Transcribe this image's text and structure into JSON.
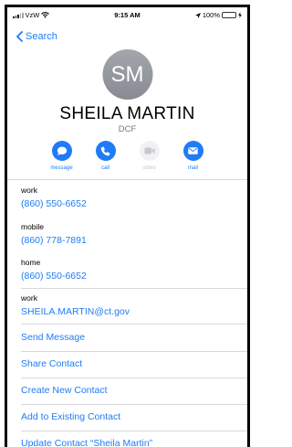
{
  "status_bar": {
    "carrier": "VzW",
    "time": "9:15 AM",
    "battery_percent": "100%"
  },
  "nav": {
    "back_label": "Search"
  },
  "contact": {
    "initials": "SM",
    "name": "SHEILA MARTIN",
    "company": "DCF"
  },
  "actions": [
    {
      "label": "message",
      "icon": "message-bubble-icon",
      "enabled": true
    },
    {
      "label": "call",
      "icon": "phone-icon",
      "enabled": true
    },
    {
      "label": "video",
      "icon": "video-camera-icon",
      "enabled": false
    },
    {
      "label": "mail",
      "icon": "envelope-icon",
      "enabled": true
    }
  ],
  "fields": [
    {
      "label": "work",
      "value": "(860) 550-6652"
    },
    {
      "label": "mobile",
      "value": "(860) 778-7891"
    },
    {
      "label": "home",
      "value": "(860) 550-6652"
    },
    {
      "label": "work",
      "value": "SHEILA.MARTIN@ct.gov"
    }
  ],
  "links": [
    "Send Message",
    "Share Contact",
    "Create New Contact",
    "Add to Existing Contact",
    "Update Contact “Sheila Martin”"
  ],
  "colors": {
    "accent": "#1f7cf6",
    "battery": "#4cd964",
    "avatar": "#9a9da4"
  }
}
